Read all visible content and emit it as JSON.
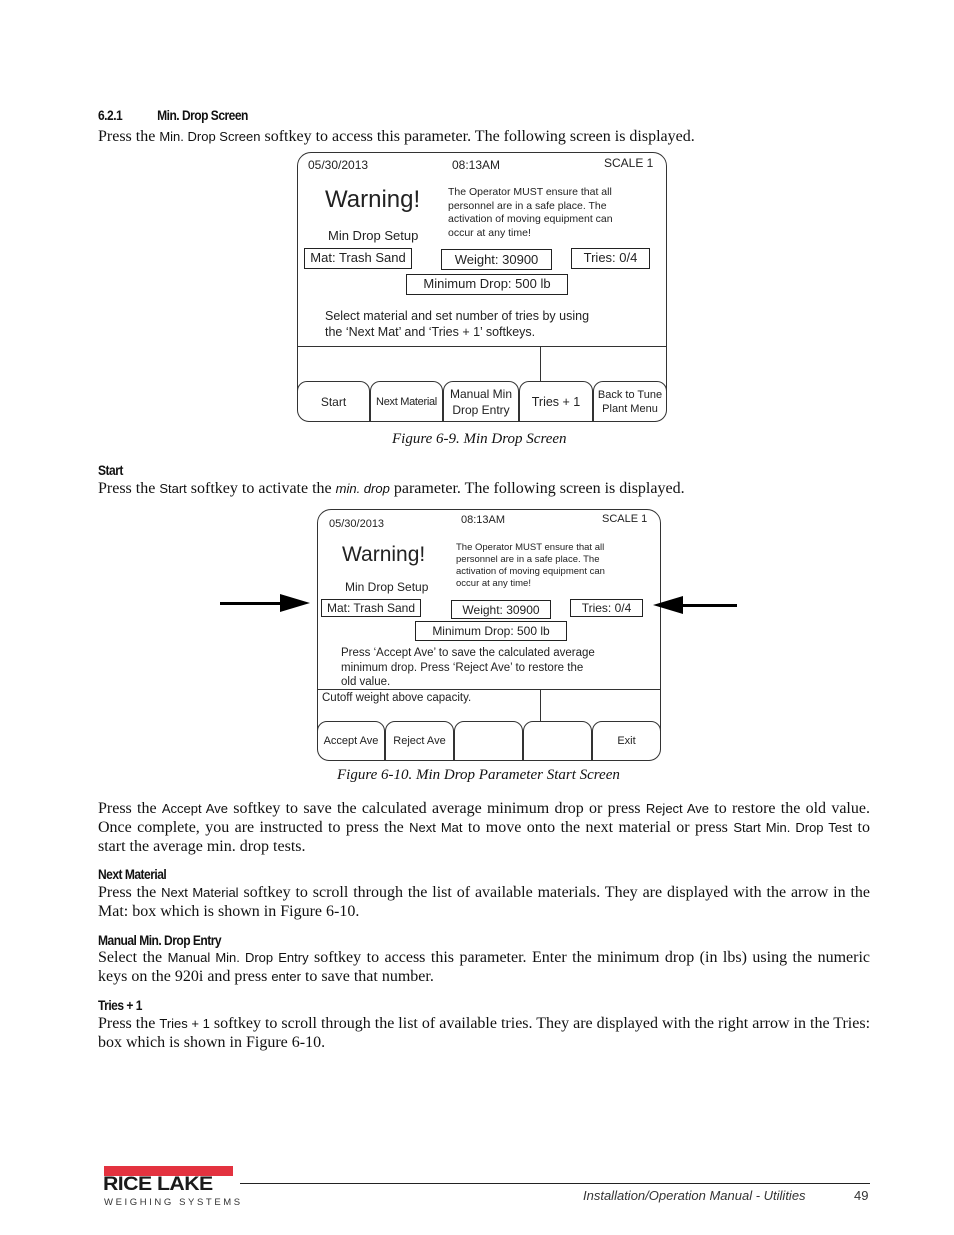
{
  "section": {
    "number": "6.2.1",
    "title": "Min. Drop Screen",
    "intro": {
      "pre": "Press the ",
      "key": "Min. Drop Screen",
      "post": " softkey to access this parameter. The following screen is displayed."
    }
  },
  "figure1": {
    "date": "05/30/2013",
    "time": "08:13AM",
    "scale": "SCALE 1",
    "warning_title": "Warning!",
    "subtitle": "Min Drop Setup",
    "warning_lines": [
      "The Operator MUST ensure that all",
      "personnel are in a safe place. The",
      "activation of moving equipment can",
      "occur at any time!"
    ],
    "mat_box": "Mat: Trash Sand",
    "weight_box": "Weight: 30900",
    "tries_box": "Tries: 0/4",
    "min_drop_box": "Minimum Drop: 500 lb",
    "instruction_lines": [
      "Select material and set number of tries by using",
      "the ‘Next Mat’ and ‘Tries + 1’ softkeys."
    ],
    "status_text": "",
    "softkeys": [
      {
        "line1": "Start",
        "line2": ""
      },
      {
        "line1": "Next Material",
        "line2": ""
      },
      {
        "line1": "Manual Min",
        "line2": "Drop Entry"
      },
      {
        "line1": "Tries + 1",
        "line2": ""
      },
      {
        "line1": "Back to Tune",
        "line2": "Plant Menu"
      }
    ],
    "caption": "Figure 6-9. Min Drop Screen"
  },
  "start_section": {
    "title": "Start",
    "pre": "Press the ",
    "key": "Start",
    "mid": " softkey to activate the ",
    "param": "min. drop",
    "post": " parameter. The following screen is displayed."
  },
  "figure2": {
    "date": "05/30/2013",
    "time": "08:13AM",
    "scale": "SCALE 1",
    "warning_title": "Warning!",
    "subtitle": "Min Drop Setup",
    "warning_lines": [
      "The Operator MUST ensure that all",
      "personnel are in a safe place. The",
      "activation of moving equipment can",
      "occur at any time!"
    ],
    "mat_box": "Mat: Trash Sand",
    "weight_box": "Weight: 30900",
    "tries_box": "Tries: 0/4",
    "min_drop_box": "Minimum Drop: 500 lb",
    "instruction_lines": [
      "Press ‘Accept Ave’ to save the calculated average",
      "minimum drop. Press ‘Reject Ave’ to restore the",
      "old value."
    ],
    "status_text": "Cutoff weight above capacity.",
    "softkeys": [
      {
        "line1": "Accept Ave"
      },
      {
        "line1": "Reject Ave"
      },
      {
        "line1": ""
      },
      {
        "line1": ""
      },
      {
        "line1": "Exit"
      }
    ],
    "caption": "Figure 6-10. Min Drop Parameter Start Screen"
  },
  "accept_para": {
    "p1": "Press the ",
    "k1": "Accept Ave",
    "p2": " softkey to save the calculated average minimum drop or press ",
    "k2": "Reject Ave",
    "p3": " to restore the old value. Once complete, you are instructed to press the ",
    "k3": "Next Mat",
    "p4": " to move onto the next material or press ",
    "k4": "Start Min. Drop Test",
    "p5": " to start the average min. drop tests."
  },
  "next_material": {
    "title": "Next Material",
    "p1": "Press the ",
    "k1": "Next Material",
    "p2": " softkey to scroll through the list of available materials. They are displayed with the arrow in the Mat: box which is shown in Figure 6-10."
  },
  "manual_entry": {
    "title": "Manual Min. Drop Entry",
    "p1": "Select the ",
    "k1": "Manual Min. Drop Entry",
    "p2": " softkey to access this parameter. Enter the minimum drop (in lbs) using the numeric keys on the 920i and press ",
    "k2": "enter",
    "p3": " to save that number."
  },
  "tries": {
    "title": "Tries + 1",
    "p1": "Press the ",
    "k1": "Tries + 1",
    "p2": " softkey to scroll through the list of available tries. They are displayed with the right arrow in the Tries: box which is shown in Figure 6-10."
  },
  "footer": {
    "logo_main": "RICE LAKE",
    "logo_sub": "WEIGHING SYSTEMS",
    "manual_title": "Installation/Operation Manual - Utilities",
    "page_number": "49"
  },
  "colors": {
    "logo_red": "#e3323f"
  }
}
